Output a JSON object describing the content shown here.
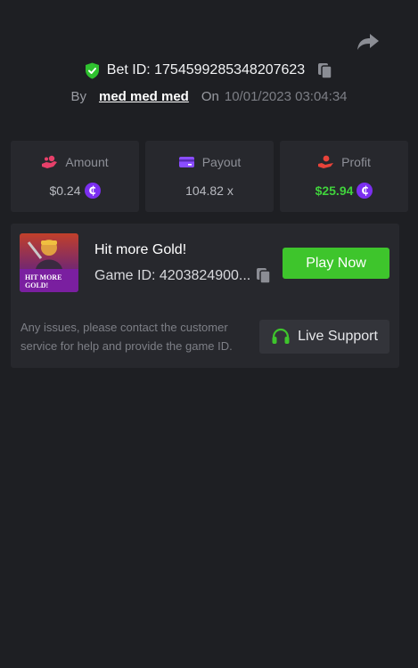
{
  "header": {
    "bet_id_label": "Bet ID: 1754599285348207623",
    "by_label": "By",
    "username": "med med med",
    "on_label": "On",
    "datetime": "10/01/2023 03:04:34"
  },
  "stats": {
    "amount": {
      "label": "Amount",
      "value": "$0.24",
      "icon": "amount-icon"
    },
    "payout": {
      "label": "Payout",
      "value": "104.82 x",
      "icon": "card-icon"
    },
    "profit": {
      "label": "Profit",
      "value": "$25.94",
      "icon": "profit-hand-icon"
    },
    "coin_glyph": "₵"
  },
  "game": {
    "title": "Hit more Gold!",
    "game_id_label": "Game ID: 4203824900...",
    "play_label": "Play Now",
    "thumb_logo_line1": "HIT MORE",
    "thumb_logo_line2": "GOLD!"
  },
  "support": {
    "note": "Any issues, please contact the customer service for help and provide the game ID.",
    "button_label": "Live Support"
  },
  "colors": {
    "background": "#1e1f23",
    "panel": "#27282d",
    "accent_green": "#3ec52c",
    "profit_green": "#40d23c",
    "coin_purple": "#7b2ff0",
    "amount_pink": "#e8406a",
    "payout_purple": "#8a4dff",
    "profit_red": "#e8433a"
  }
}
